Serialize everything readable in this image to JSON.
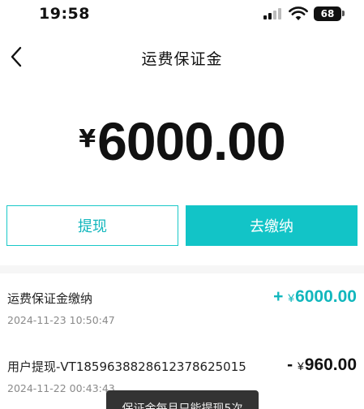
{
  "status_bar": {
    "time": "19:58",
    "battery": "68",
    "wifi_icon": "wifi-icon",
    "signal_icon": "cellular-signal-icon"
  },
  "nav": {
    "back_icon": "chevron-left-icon",
    "title": "运费保证金"
  },
  "balance": {
    "currency": "¥",
    "amount": "6000.00"
  },
  "actions": {
    "withdraw_label": "提现",
    "pay_label": "去缴纳"
  },
  "records": [
    {
      "title": "运费保证金缴纳",
      "time": "2024-11-23 10:50:47",
      "sign": "+",
      "currency": "¥",
      "amount": "6000.00"
    },
    {
      "title": "用户提现-VT185963882861237862​5015",
      "time": "2024-11-22 00:43:43",
      "sign": "-",
      "currency": "¥",
      "amount": "960.00"
    }
  ],
  "toast": {
    "message": "保证金每月只能提现5次"
  },
  "colors": {
    "accent": "#12c4c7",
    "accent_text": "#12b7bd",
    "text": "#111111",
    "muted": "#8a8a8a"
  }
}
